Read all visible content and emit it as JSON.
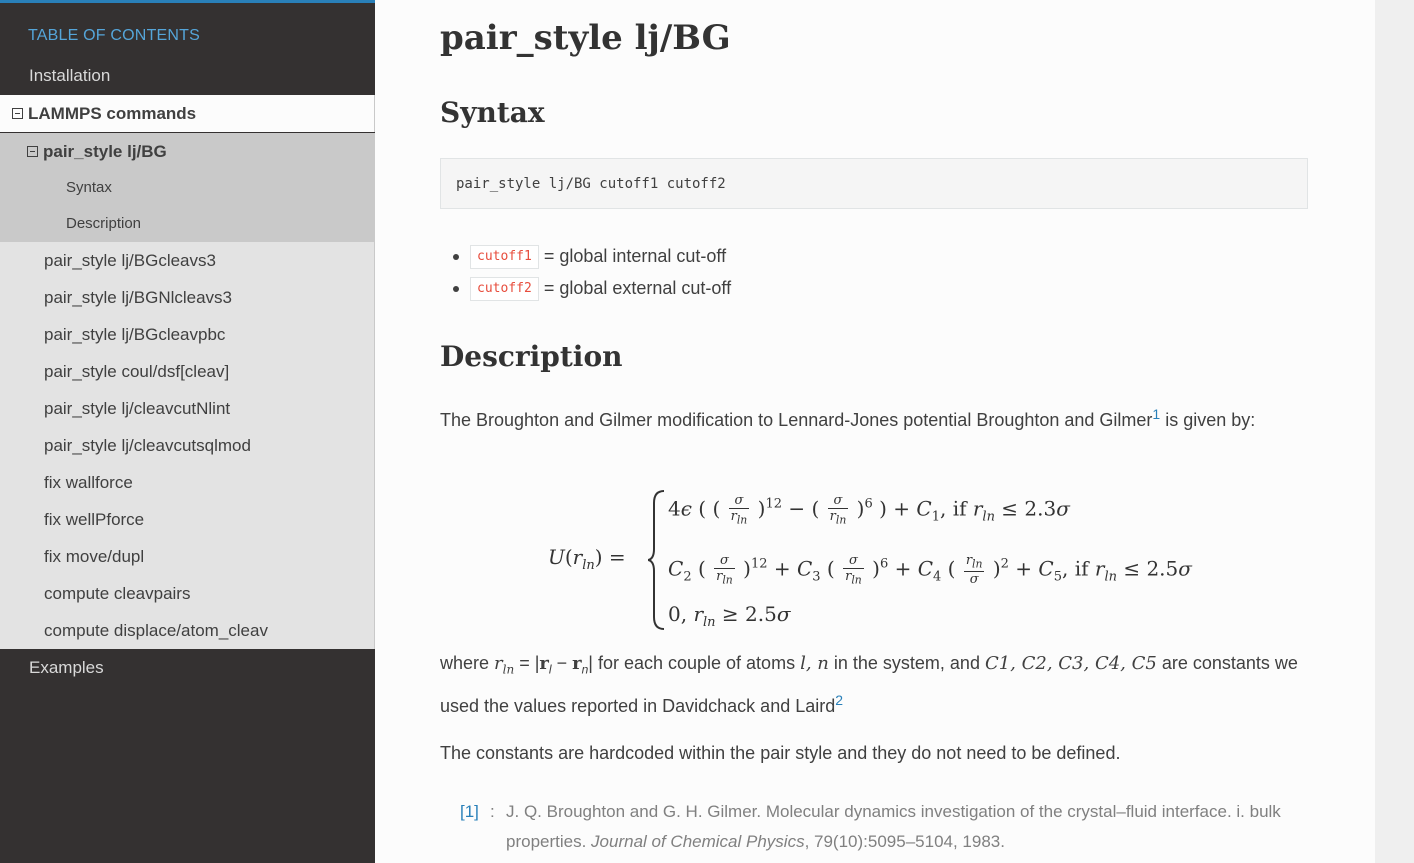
{
  "sidebar": {
    "caption": "TABLE OF CONTENTS",
    "installation": "Installation",
    "lammps_commands": "LAMMPS commands",
    "current_page": "pair_style lj/BG",
    "sub_items": [
      "Syntax",
      "Description"
    ],
    "items": [
      "pair_style lj/BGcleavs3",
      "pair_style lj/BGNlcleavs3",
      "pair_style lj/BGcleavpbc",
      "pair_style coul/dsf[cleav]",
      "pair_style lj/cleavcutNlint",
      "pair_style lj/cleavcutsqlmod",
      "fix wallforce",
      "fix wellPforce",
      "fix move/dupl",
      "compute cleavpairs",
      "compute displace/atom_cleav"
    ],
    "examples": "Examples"
  },
  "page": {
    "title": "pair_style lj/BG",
    "syntax_heading": "Syntax",
    "syntax_code": "pair_style lj/BG cutoff1 cutoff2",
    "args": [
      {
        "name": "cutoff1",
        "desc": "= global internal cut-off"
      },
      {
        "name": "cutoff2",
        "desc": "= global external cut-off"
      }
    ],
    "description_heading": "Description",
    "intro_text": "The Broughton and Gilmer modification to Lennard-Jones potential Broughton and Gilmer",
    "intro_ref": "1",
    "intro_tail": " is given by:",
    "where_prefix": "where ",
    "where_mid": " for each couple of atoms ",
    "where_atoms": "l, n",
    "where_mid2": " in the system, and ",
    "where_constants": "C1, C2, C3, C4, C5",
    "where_tail": " are constants we used the values reported in Davidchack and Laird",
    "where_ref": "2",
    "hardcoded_text": "The constants are hardcoded within the pair style and they do not need to be defined.",
    "citation_label": "[1]",
    "citation_text": "J. Q. Broughton and G. H. Gilmer. Molecular dynamics investigation of the crystal–fluid interface. i. bulk properties. ",
    "citation_journal": "Journal of Chemical Physics",
    "citation_tail": ", 79(10):5095–5104, 1983."
  }
}
